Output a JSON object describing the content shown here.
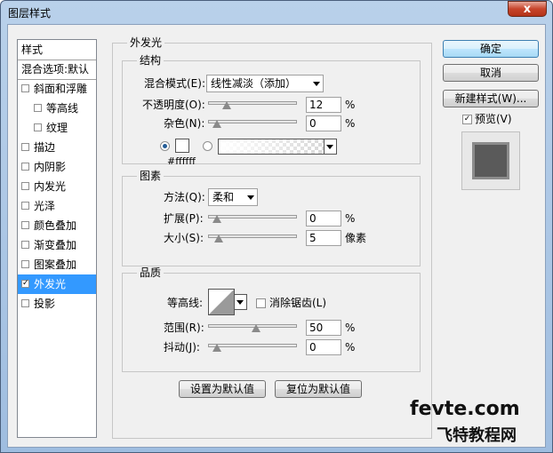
{
  "window": {
    "title": "图层样式",
    "close": "x"
  },
  "styles_list": [
    {
      "label": "样式",
      "checkbox": false,
      "header": true
    },
    {
      "label": "混合选项:默认",
      "checkbox": false,
      "header": true
    },
    {
      "label": "斜面和浮雕",
      "checkbox": true,
      "checked": false
    },
    {
      "label": "等高线",
      "checkbox": true,
      "checked": false,
      "indent": true
    },
    {
      "label": "纹理",
      "checkbox": true,
      "checked": false,
      "indent": true
    },
    {
      "label": "描边",
      "checkbox": true,
      "checked": false
    },
    {
      "label": "内阴影",
      "checkbox": true,
      "checked": false
    },
    {
      "label": "内发光",
      "checkbox": true,
      "checked": false
    },
    {
      "label": "光泽",
      "checkbox": true,
      "checked": false
    },
    {
      "label": "颜色叠加",
      "checkbox": true,
      "checked": false
    },
    {
      "label": "渐变叠加",
      "checkbox": true,
      "checked": false
    },
    {
      "label": "图案叠加",
      "checkbox": true,
      "checked": false
    },
    {
      "label": "外发光",
      "checkbox": true,
      "checked": true,
      "selected": true
    },
    {
      "label": "投影",
      "checkbox": true,
      "checked": false
    }
  ],
  "panel": {
    "title": "外发光",
    "structure": {
      "title": "结构",
      "blend_mode_label": "混合模式(E):",
      "blend_mode_value": "线性减淡（添加）",
      "opacity_label": "不透明度(O):",
      "opacity_value": "12",
      "opacity_level": 0.12,
      "noise_label": "杂色(N):",
      "noise_value": "0",
      "noise_level": 0,
      "percent": "%",
      "color_hex": "#ffffff",
      "color_swatch": "#ffffff"
    },
    "elements": {
      "title": "图素",
      "technique_label": "方法(Q):",
      "technique_value": "柔和",
      "spread_label": "扩展(P):",
      "spread_value": "0",
      "spread_level": 0,
      "size_label": "大小(S):",
      "size_value": "5",
      "size_level": 0.02,
      "percent": "%",
      "size_unit": "像素"
    },
    "quality": {
      "title": "品质",
      "contour_label": "等高线:",
      "antialias_label": "消除锯齿(L)",
      "range_label": "范围(R):",
      "range_value": "50",
      "range_level": 0.5,
      "jitter_label": "抖动(J):",
      "jitter_value": "0",
      "jitter_level": 0,
      "percent": "%"
    },
    "make_default": "设置为默认值",
    "reset_default": "复位为默认值"
  },
  "actions": {
    "ok": "确定",
    "cancel": "取消",
    "new_style": "新建样式(W)...",
    "preview_label": "预览(V)"
  },
  "watermark": {
    "line1": "fevte.com",
    "line2": "飞特教程网"
  }
}
